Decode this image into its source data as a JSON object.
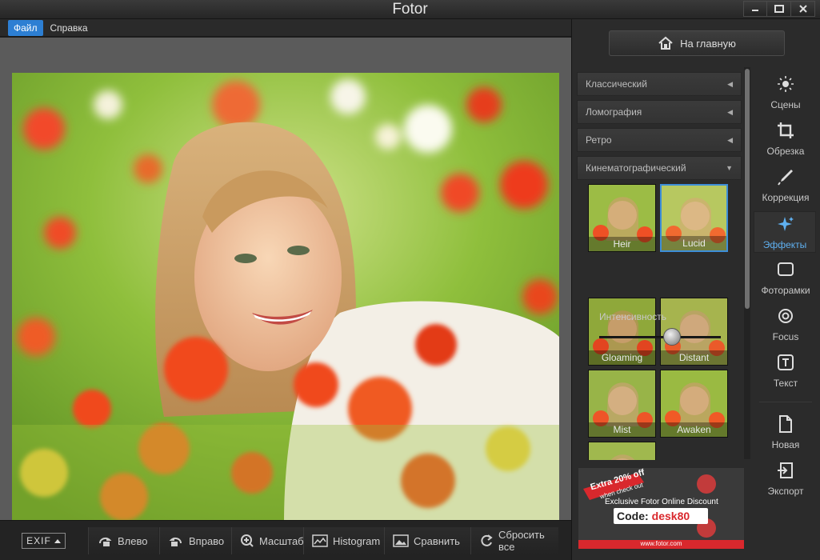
{
  "window": {
    "title": "Fotor",
    "controls": [
      "minimize",
      "maximize",
      "close"
    ]
  },
  "menu": {
    "items": [
      {
        "label": "Файл",
        "active": true
      },
      {
        "label": "Справка",
        "active": false
      }
    ]
  },
  "header": {
    "home_label": "На главную"
  },
  "categories": [
    {
      "label": "Классический",
      "expanded": false
    },
    {
      "label": "Ломография",
      "expanded": false
    },
    {
      "label": "Ретро",
      "expanded": false
    },
    {
      "label": "Кинематографический",
      "expanded": true
    }
  ],
  "effects": {
    "intensity_label": "Интенсивность",
    "intensity_value": 0.6,
    "items": [
      {
        "label": "Heir",
        "selected": false
      },
      {
        "label": "Lucid",
        "selected": true
      },
      {
        "label": "Gloaming",
        "selected": false
      },
      {
        "label": "Distant",
        "selected": false
      },
      {
        "label": "Mist",
        "selected": false
      },
      {
        "label": "Awaken",
        "selected": false
      },
      {
        "label": "",
        "selected": false
      }
    ]
  },
  "sidebar": {
    "items": [
      {
        "label": "Сцены",
        "icon": "sun-icon",
        "active": false
      },
      {
        "label": "Обрезка",
        "icon": "crop-icon",
        "active": false
      },
      {
        "label": "Коррекция",
        "icon": "brush-icon",
        "active": false
      },
      {
        "label": "Эффекты",
        "icon": "sparkle-icon",
        "active": true
      },
      {
        "label": "Фоторамки",
        "icon": "frame-icon",
        "active": false
      },
      {
        "label": "Focus",
        "icon": "focus-icon",
        "active": false
      },
      {
        "label": "Текст",
        "icon": "text-icon",
        "active": false
      },
      {
        "label": "Новая",
        "icon": "new-file-icon",
        "active": false
      },
      {
        "label": "Экспорт",
        "icon": "export-icon",
        "active": false
      }
    ]
  },
  "toolbar": {
    "exif_label": "EXIF",
    "items": [
      {
        "label": "Влево",
        "icon": "rotate-left-icon"
      },
      {
        "label": "Вправо",
        "icon": "rotate-right-icon"
      },
      {
        "label": "Масштаб",
        "icon": "zoom-icon"
      },
      {
        "label": "Histogram",
        "icon": "histogram-icon"
      },
      {
        "label": "Сравнить",
        "icon": "compare-icon"
      },
      {
        "label": "Сбросить все",
        "icon": "reset-icon"
      }
    ]
  },
  "ad": {
    "ribbon_line1": "Extra 20% off",
    "ribbon_line2": "when check out",
    "headline": "Exclusive Fotor Online Discount",
    "code_label": "Code:",
    "code_value": "desk80",
    "url": "www.fotor.com"
  },
  "colors": {
    "accent": "#2d7fd3",
    "selected_border": "#3d8ed8",
    "active_tool": "#5fb0f0",
    "ad_red": "#d9282d"
  }
}
